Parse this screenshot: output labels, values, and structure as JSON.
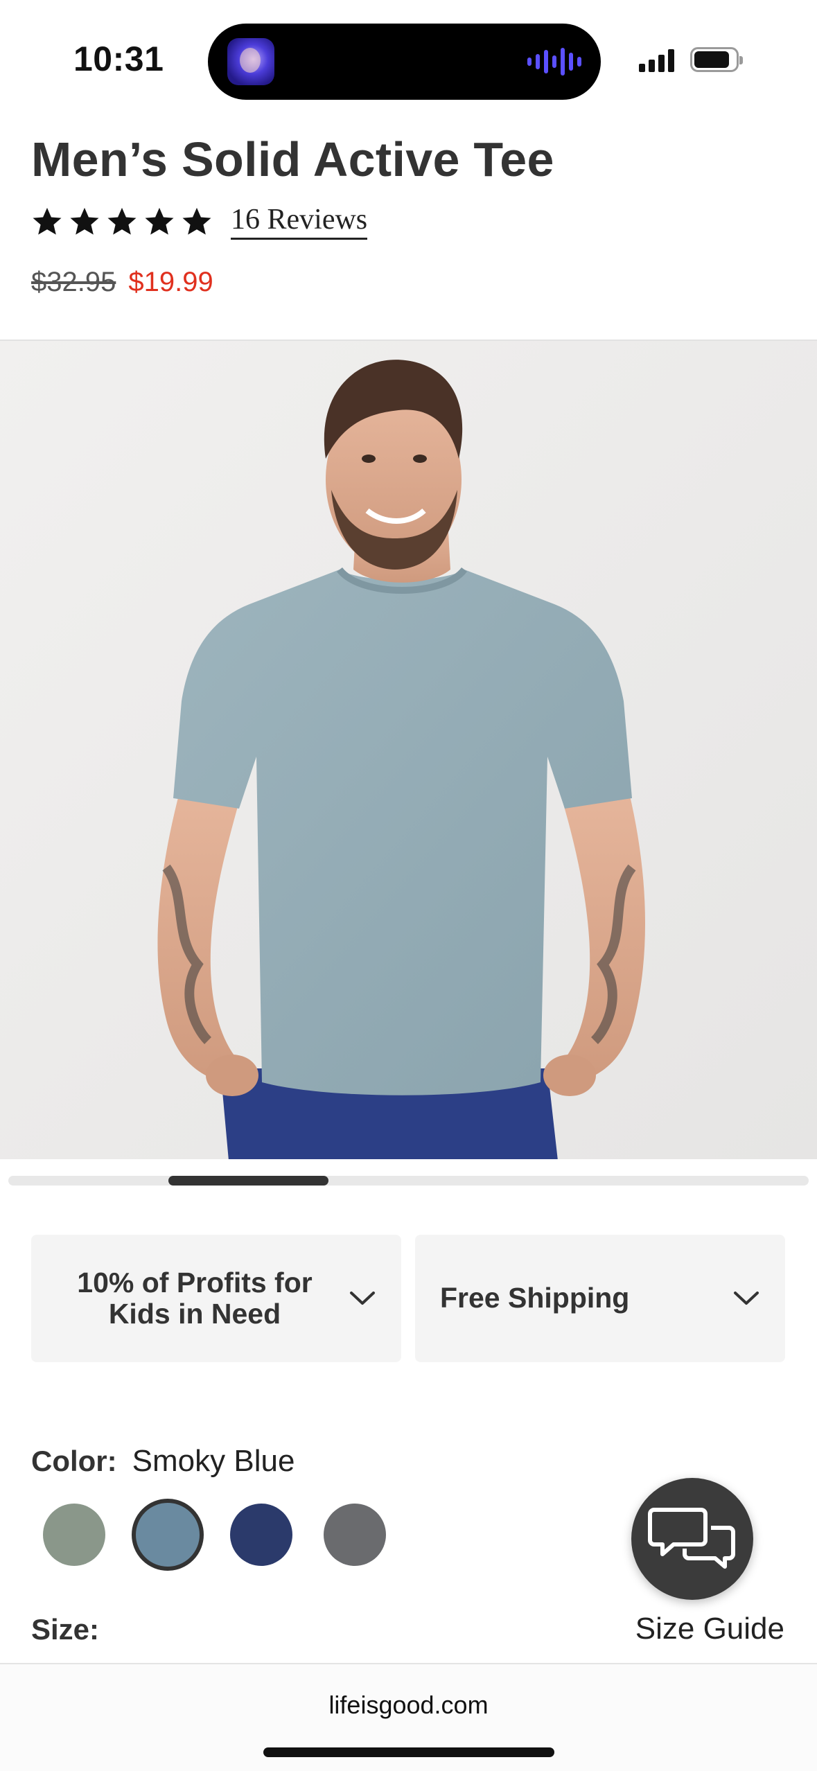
{
  "status_bar": {
    "time": "10:31"
  },
  "product": {
    "title": "Men’s Solid Active Tee",
    "rating_stars": 5,
    "reviews_label": "16 Reviews",
    "price_original": "$32.95",
    "price_sale": "$19.99"
  },
  "gallery": {
    "image_icon": "product-photo-man-in-tee",
    "position": "2 of 5"
  },
  "info_cards": [
    {
      "label": "10% of Profits for Kids in Need"
    },
    {
      "label": "Free Shipping"
    }
  ],
  "color": {
    "label": "Color:",
    "selected": "Smoky Blue",
    "swatches": [
      {
        "color": "#8a978a"
      },
      {
        "color": "#6a8aa0"
      },
      {
        "color": "#2b3a6b"
      },
      {
        "color": "#6a6b6e"
      }
    ]
  },
  "size": {
    "label": "Size:",
    "guide_label": "Size Guide"
  },
  "chat": {
    "icon": "chat-bubbles-icon"
  },
  "browser": {
    "url": "lifeisgood.com"
  },
  "colors": {
    "sale_price": "#e0301e",
    "text_primary": "#333333",
    "card_background": "#f4f4f4"
  }
}
